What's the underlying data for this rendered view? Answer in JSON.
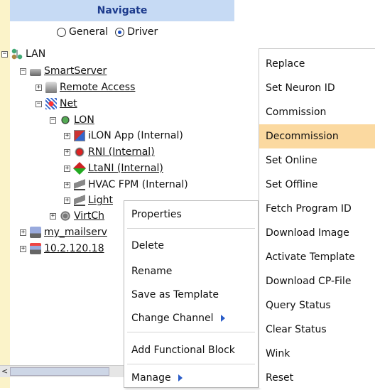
{
  "header": {
    "title": "Navigate"
  },
  "radio": {
    "general_label": "General",
    "driver_label": "Driver",
    "selected": "Driver"
  },
  "tree": {
    "lan": "LAN",
    "smartserver": "SmartServer",
    "remote_access": "Remote Access",
    "net": "Net",
    "lon": "LON",
    "ilon_app": "iLON App (Internal)",
    "rni": "RNI (Internal)",
    "ltani": "LtaNI (Internal)",
    "hvac_fpm": "HVAC FPM (Internal)",
    "light": "Light",
    "virtch": "VirtCh",
    "my_mailserver": "my_mailserv",
    "ip_node": "10.2.120.18"
  },
  "context_menu": {
    "properties": "Properties",
    "delete": "Delete",
    "rename": "Rename",
    "save_as_template": "Save as Template",
    "change_channel": "Change Channel",
    "add_functional_block": "Add Functional Block",
    "manage": "Manage"
  },
  "submenu": {
    "items": [
      "Replace",
      "Set Neuron ID",
      "Commission",
      "Decommission",
      "Set Online",
      "Set Offline",
      "Fetch Program ID",
      "Download Image",
      "Activate Template",
      "Download CP-File",
      "Query Status",
      "Clear Status",
      "Wink",
      "Reset"
    ],
    "highlighted": "Decommission"
  },
  "colors": {
    "header_bg": "#c6daf4",
    "strip_bg": "#fbf3c9",
    "highlight": "#fbd9a0",
    "accent": "#2a5cc8"
  }
}
